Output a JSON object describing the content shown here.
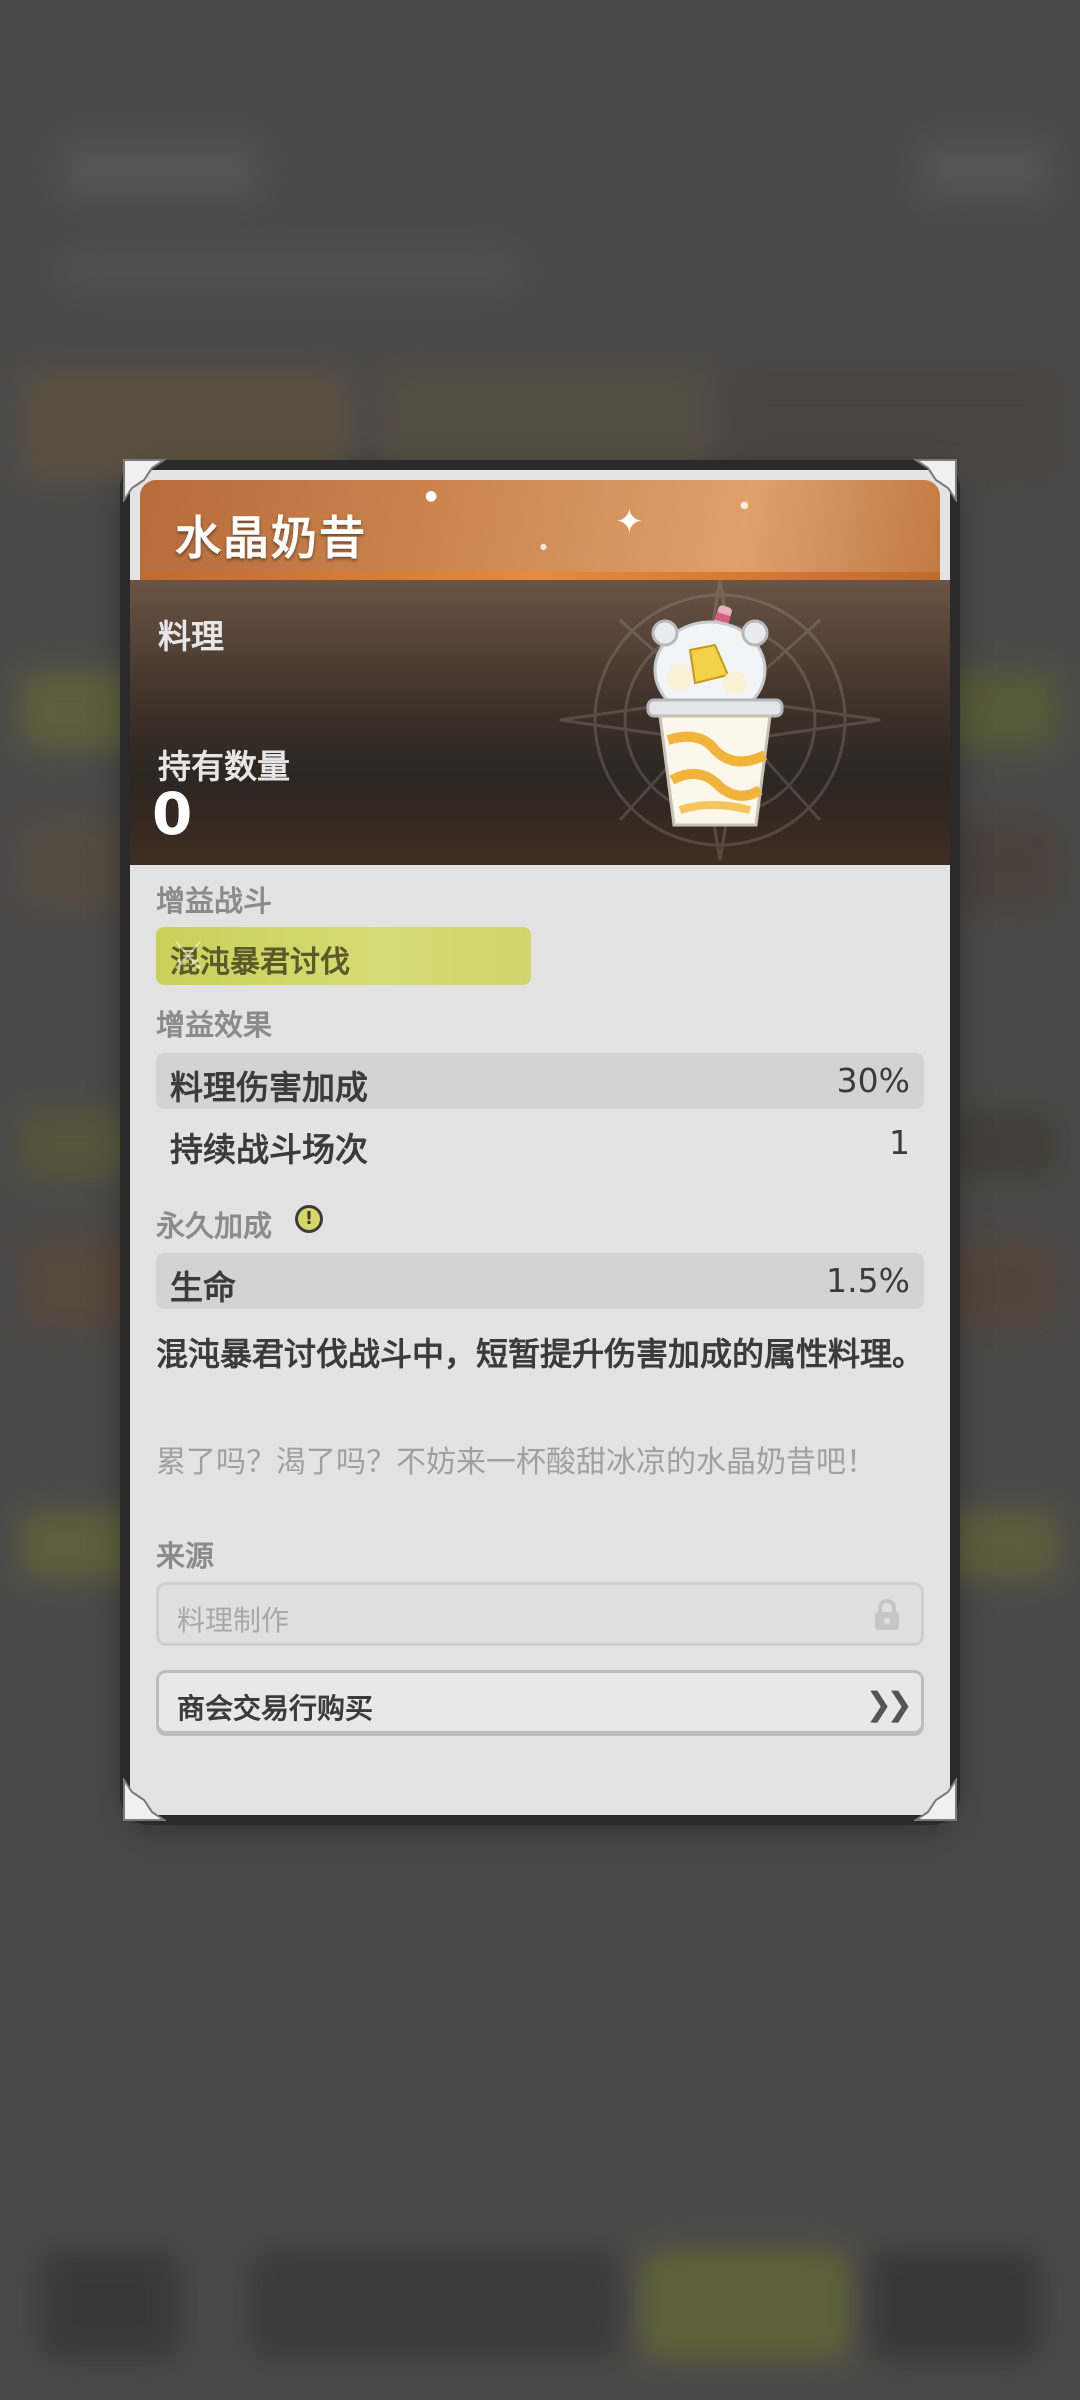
{
  "colors": {
    "title_bar": "#c97f47",
    "accent_yellow": "#d6dc74",
    "card_bg": "#e3e3e3"
  },
  "card": {
    "title": "水晶奶昔",
    "category": "料理",
    "owned_label": "持有数量",
    "owned_value": "0",
    "item_icon": "milkshake-cup-icon"
  },
  "buff_battle": {
    "label": "增益战斗",
    "tag": "混沌暴君讨伐"
  },
  "buff_effects": {
    "label": "增益效果",
    "rows": [
      {
        "name": "料理伤害加成",
        "value": "30%"
      },
      {
        "name": "持续战斗场次",
        "value": "1"
      }
    ]
  },
  "permanent_bonus": {
    "label": "永久加成",
    "info_icon": "exclamation-icon",
    "rows": [
      {
        "name": "生命",
        "value": "1.5%"
      }
    ]
  },
  "description": "混沌暴君讨伐战斗中，短暂提升伤害加成的属性料理。",
  "flavor_text": "累了吗？渴了吗？不妨来一杯酸甜冰凉的水晶奶昔吧！",
  "source": {
    "label": "来源",
    "items": [
      {
        "label": "料理制作",
        "state": "locked",
        "icon": "lock-icon"
      },
      {
        "label": "商会交易行购买",
        "state": "available",
        "icon": "double-chevron-right-icon"
      }
    ]
  }
}
